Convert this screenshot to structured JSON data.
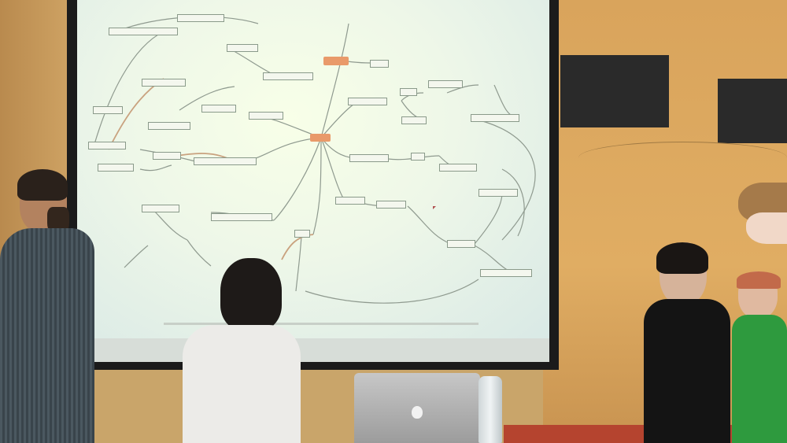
{
  "scene": {
    "description_hidden": "",
    "colors": {
      "screen": "#eef7e8",
      "wall": "#e0ad63",
      "frame": "#1b1b1b",
      "hub": "#e99a6a",
      "link": "#8f9a8f",
      "link_accent": "#c9a27f"
    },
    "mindmap_nodes": [
      {
        "id": "n1",
        "text": ""
      },
      {
        "id": "n2",
        "text": ""
      },
      {
        "id": "n3",
        "text": ""
      },
      {
        "id": "n4",
        "text": ""
      },
      {
        "id": "n5",
        "text": ""
      },
      {
        "id": "n6",
        "text": ""
      },
      {
        "id": "n7",
        "text": ""
      },
      {
        "id": "n8",
        "text": ""
      },
      {
        "id": "n9",
        "text": ""
      },
      {
        "id": "n10",
        "text": ""
      },
      {
        "id": "n11",
        "text": ""
      },
      {
        "id": "n12",
        "text": ""
      },
      {
        "id": "n13",
        "text": ""
      },
      {
        "id": "n14",
        "text": ""
      },
      {
        "id": "n15",
        "text": ""
      },
      {
        "id": "n16",
        "text": ""
      },
      {
        "id": "n17",
        "text": ""
      },
      {
        "id": "n18",
        "text": ""
      },
      {
        "id": "n19",
        "text": ""
      },
      {
        "id": "n20",
        "text": ""
      },
      {
        "id": "n21",
        "text": ""
      },
      {
        "id": "n22",
        "text": ""
      },
      {
        "id": "n23",
        "text": ""
      },
      {
        "id": "n24",
        "text": ""
      },
      {
        "id": "n25",
        "text": ""
      },
      {
        "id": "n26",
        "text": ""
      },
      {
        "id": "n27",
        "text": ""
      },
      {
        "id": "n28",
        "text": ""
      },
      {
        "id": "n29",
        "text": ""
      },
      {
        "id": "n30",
        "text": ""
      }
    ],
    "icons": {
      "laptop_logo": "apple-logo-icon"
    }
  }
}
